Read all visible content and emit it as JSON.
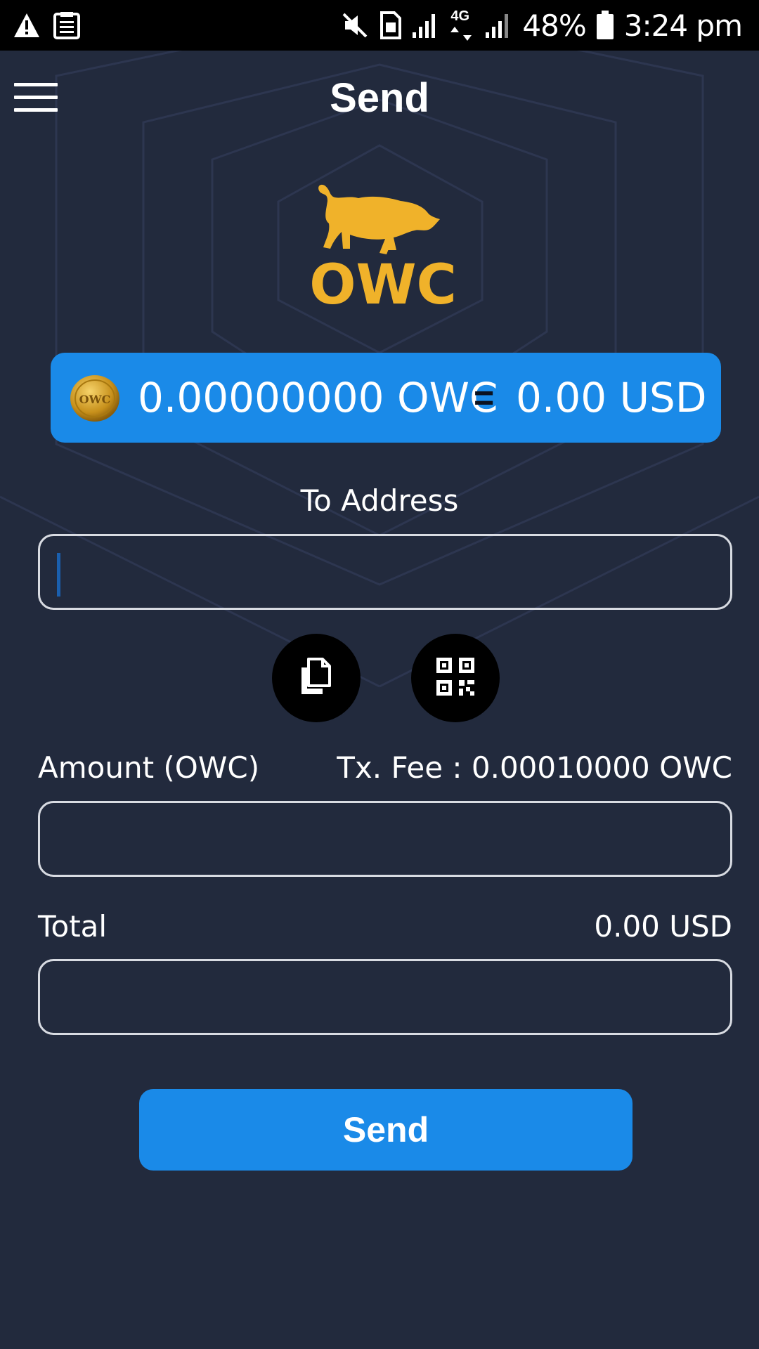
{
  "status_bar": {
    "battery": "48%",
    "time": "3:24 pm",
    "network": "4G",
    "left_icons": [
      "warning-icon",
      "clipboard-icon"
    ],
    "right_icons": [
      "mute-icon",
      "sim-icon",
      "signal-icon",
      "signal-icon",
      "battery-icon"
    ]
  },
  "header": {
    "title": "Send",
    "menu_icon": "hamburger-menu-icon"
  },
  "logo": {
    "text": "OWC"
  },
  "balance": {
    "owc": "0.00000000 OWC",
    "equals": "=",
    "usd": "0.00 USD",
    "coin_icon": "owc-coin-icon"
  },
  "form": {
    "to_address_label": "To Address",
    "to_address_value": "",
    "paste_icon": "paste-icon",
    "qr_icon": "qr-code-icon",
    "amount_label": "Amount (OWC)",
    "tx_fee_label": "Tx. Fee : 0.00010000 OWC",
    "amount_value": "",
    "total_label": "Total",
    "total_usd": "0.00 USD",
    "total_value": ""
  },
  "actions": {
    "send_label": "Send"
  },
  "colors": {
    "background": "#222a3d",
    "accent": "#1a8ae8",
    "logo_gold": "#f0b22a",
    "status_bar": "#000000"
  }
}
